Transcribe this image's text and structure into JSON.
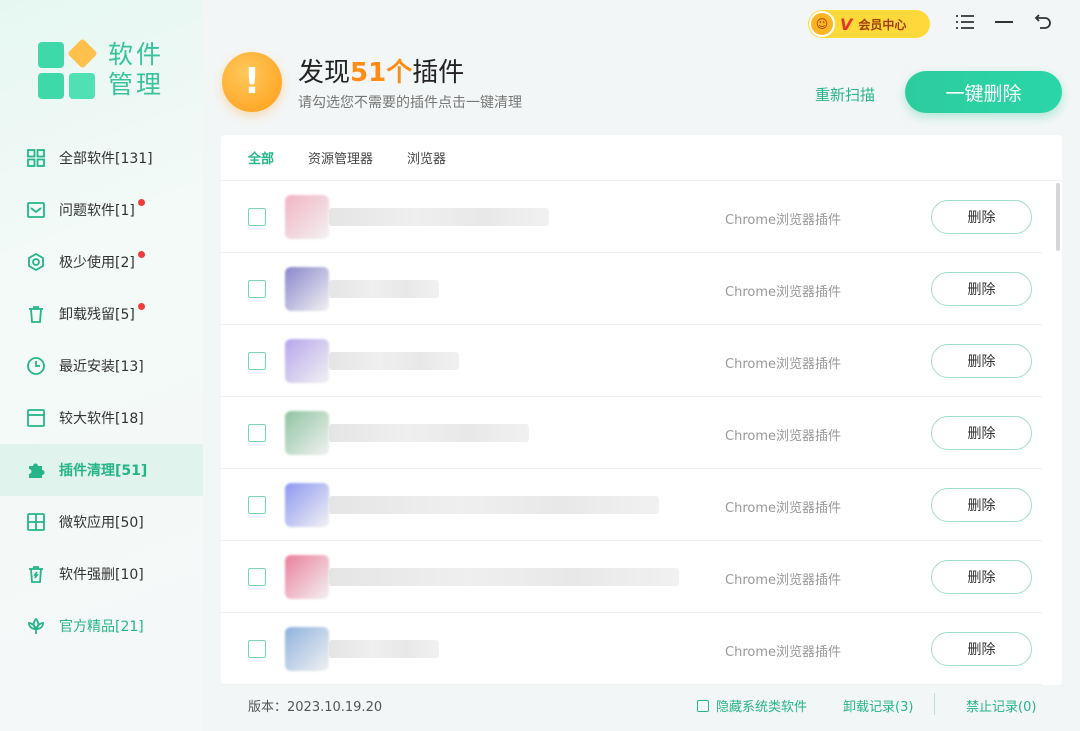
{
  "sidebar": {
    "logo_text": "软件管理",
    "items": [
      {
        "label": "全部软件[131]",
        "dot": false,
        "active": false
      },
      {
        "label": "问题软件[1]",
        "dot": true,
        "active": false
      },
      {
        "label": "极少使用[2]",
        "dot": true,
        "active": false
      },
      {
        "label": "卸载残留[5]",
        "dot": true,
        "active": false
      },
      {
        "label": "最近安装[13]",
        "dot": false,
        "active": false
      },
      {
        "label": "较大软件[18]",
        "dot": false,
        "active": false
      },
      {
        "label": "插件清理[51]",
        "dot": false,
        "active": true
      },
      {
        "label": "微软应用[50]",
        "dot": false,
        "active": false
      },
      {
        "label": "软件强删[10]",
        "dot": false,
        "active": false
      },
      {
        "label": "官方精品[21]",
        "dot": false,
        "active": false
      }
    ]
  },
  "topbar": {
    "vip_label": "会员中心",
    "vip_v": "V"
  },
  "header": {
    "title_prefix": "发现",
    "title_count": "51个",
    "title_suffix": "插件",
    "subtitle": "请勾选您不需要的插件点击一键清理",
    "rescan_label": "重新扫描",
    "delete_all_label": "一键删除"
  },
  "tabs": [
    {
      "label": "全部",
      "active": true
    },
    {
      "label": "资源管理器",
      "active": false
    },
    {
      "label": "浏览器",
      "active": false
    }
  ],
  "plugins": {
    "rows": [
      {
        "type": "Chrome浏览器插件",
        "action": "删除",
        "color": "#f2b4c4"
      },
      {
        "type": "Chrome浏览器插件",
        "action": "删除",
        "color": "#8a86cc"
      },
      {
        "type": "Chrome浏览器插件",
        "action": "删除",
        "color": "#b6a6ec"
      },
      {
        "type": "Chrome浏览器插件",
        "action": "删除",
        "color": "#8fc4a0"
      },
      {
        "type": "Chrome浏览器插件",
        "action": "删除",
        "color": "#8d98f2"
      },
      {
        "type": "Chrome浏览器插件",
        "action": "删除",
        "color": "#eb7f9d"
      },
      {
        "type": "Chrome浏览器插件",
        "action": "删除",
        "color": "#8fb2de"
      }
    ]
  },
  "footer": {
    "version": "版本：2023.10.19.20",
    "hide_system_label": "隐藏系统类软件",
    "uninstall_log": "卸载记录(3)",
    "forbid_log": "禁止记录(0)"
  },
  "colors": {
    "accent": "#25b588",
    "warning": "#ff8c14",
    "badge_dot": "#f23b3b"
  }
}
